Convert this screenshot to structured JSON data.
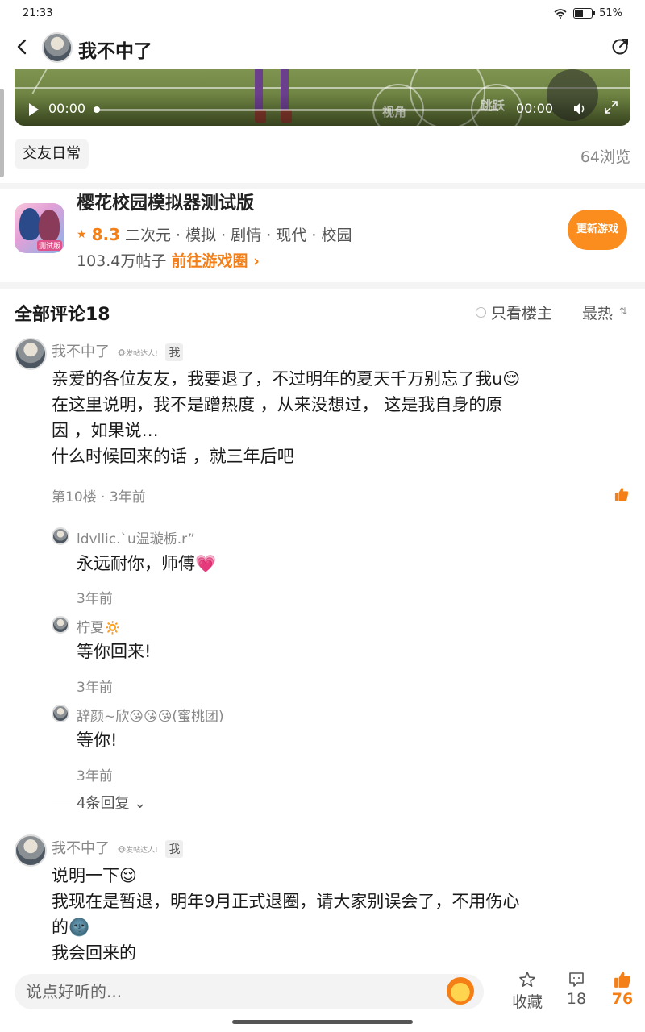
{
  "status_bar": {
    "time": "21:33",
    "battery": "51%"
  },
  "header": {
    "title": "我不中了"
  },
  "video": {
    "current_time": "00:00",
    "duration": "00:00",
    "overlay_labels": [
      "视角",
      "跳跃"
    ]
  },
  "post": {
    "tag": "交友日常",
    "views": "64浏览"
  },
  "game": {
    "title": "樱花校园模拟器测试版",
    "rating": "8.3",
    "genres": "二次元 · 模拟 · 剧情 · 现代 · 校园",
    "posts": "103.4万帖子",
    "link": "前往游戏圈",
    "update_button": "更新游戏",
    "icon_badge": "测试版"
  },
  "comments_header": {
    "title": "全部评论18",
    "only_host": "只看楼主",
    "sort": "最热"
  },
  "comments": [
    {
      "author": "我不中了",
      "badge": "发帖达人!",
      "me_tag": "我",
      "lines": [
        "亲爱的各位友友，我要退了，不过明年的夏天千万别忘了我u😌",
        "在这里说明，我不是蹭热度 ，从来没想过， 这是我自身的原",
        "因 ，如果说…",
        "什么时候回来的话 ，就三年后吧"
      ],
      "meta": "第10楼 · 3年前",
      "replies": [
        {
          "name": "ldvllic.`u温璇栃.r”",
          "text": "永远耐你，师傅💗",
          "time": "3年前"
        },
        {
          "name": "柠夏🔅",
          "text": "等你回来!",
          "time": "3年前"
        },
        {
          "name": "辞颜~欣😘😘😘(蜜桃团)",
          "text": "等你!",
          "time": "3年前"
        }
      ],
      "more_replies": "4条回复"
    },
    {
      "author": "我不中了",
      "badge": "发帖达人!",
      "me_tag": "我",
      "lines": [
        "说明一下😌",
        "我现在是暂退，明年9月正式退圈，请大家别误会了，不用伤心",
        "的🌚",
        "我会回来的"
      ]
    }
  ],
  "bottom_bar": {
    "input_placeholder": "说点好听的...",
    "favorite_label": "收藏",
    "comment_count": "18",
    "like_count": "76"
  },
  "colors": {
    "accent": "#f57f17",
    "button": "#fb8c1e",
    "divider": "#f4f4f4"
  }
}
